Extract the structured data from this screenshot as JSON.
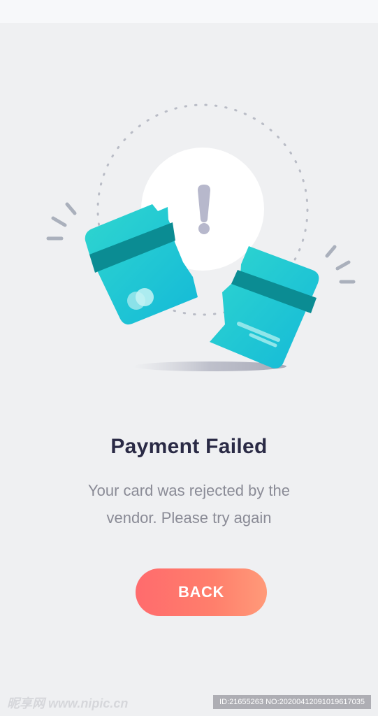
{
  "status": {
    "title": "Payment Failed",
    "message": "Your card was rejected by the vendor. Please try again"
  },
  "actions": {
    "back_label": "BACK"
  },
  "colors": {
    "accent_gradient_start": "#ff6b6d",
    "accent_gradient_end": "#ff9a79",
    "card_teal": "#1ec9d2",
    "card_stripe": "#0b8c93",
    "title_color": "#2a2a45",
    "message_color": "#8a8b96",
    "background": "#eff0f2"
  },
  "icons": {
    "alert": "exclamation-icon",
    "card": "broken-credit-card-icon"
  },
  "watermark": {
    "left_text": "昵享网 www.nipic.cn",
    "right_text": "ID:21655263 NO:20200412091019617035"
  }
}
